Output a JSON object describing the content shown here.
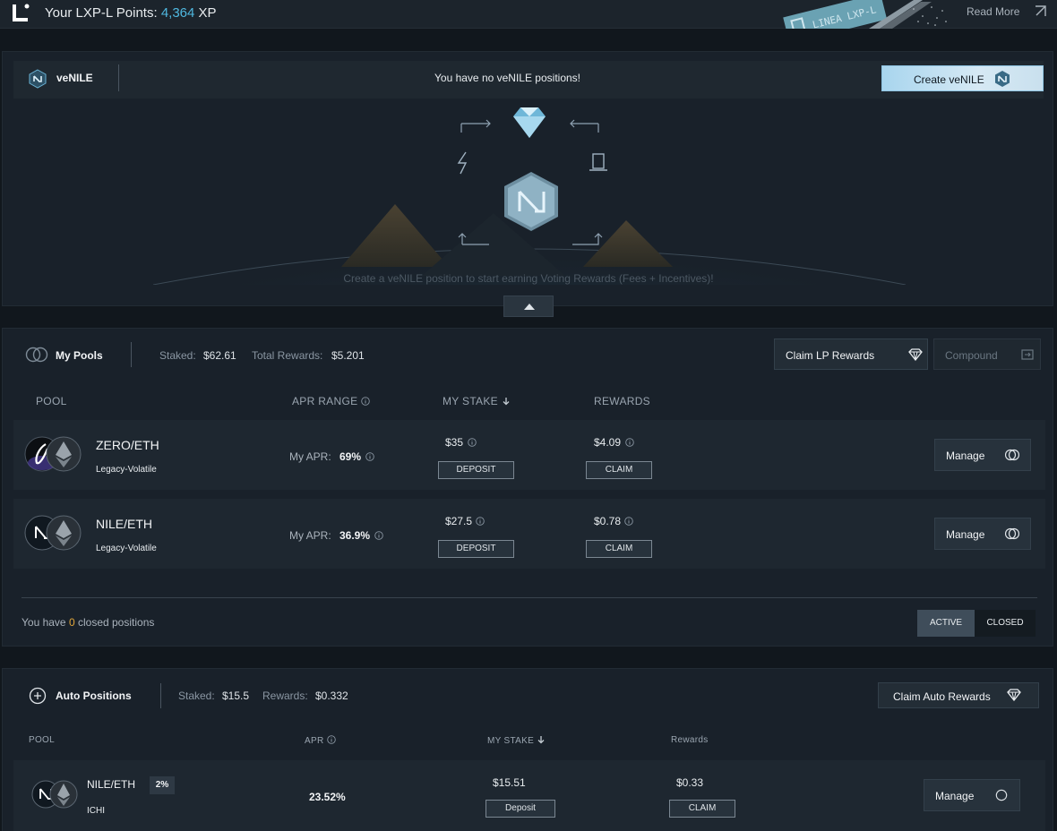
{
  "topbar": {
    "points_label": "Your LXP-L Points:",
    "points_value": "4,364",
    "points_unit": "XP",
    "banner_text": "LINEA LXP-L",
    "read_more": "Read More"
  },
  "venile": {
    "title": "veNILE",
    "empty_message": "You have no veNILE positions!",
    "create_button": "Create veNILE",
    "hint": "Create a veNILE position to start earning Voting Rewards (Fees + Incentives)!"
  },
  "my_pools": {
    "title": "My Pools",
    "staked_label": "Staked:",
    "staked_value": "$62.61",
    "rewards_label": "Total Rewards:",
    "rewards_value": "$5.201",
    "claim_button": "Claim LP Rewards",
    "compound_button": "Compound",
    "columns": {
      "pool": "POOL",
      "apr": "APR RANGE",
      "stake": "MY STAKE",
      "rewards": "REWARDS"
    },
    "rows": [
      {
        "name": "ZERO/ETH",
        "type": "Legacy-Volatile",
        "apr_label": "My APR:",
        "apr": "69%",
        "stake": "$35",
        "deposit": "DEPOSIT",
        "rewards": "$4.09",
        "claim": "CLAIM",
        "manage": "Manage"
      },
      {
        "name": "NILE/ETH",
        "type": "Legacy-Volatile",
        "apr_label": "My APR:",
        "apr": "36.9%",
        "stake": "$27.5",
        "deposit": "DEPOSIT",
        "rewards": "$0.78",
        "claim": "CLAIM",
        "manage": "Manage"
      }
    ],
    "closed_prefix": "You have",
    "closed_count": "0",
    "closed_suffix": "closed positions",
    "toggle_active": "ACTIVE",
    "toggle_closed": "CLOSED"
  },
  "auto_positions": {
    "title": "Auto Positions",
    "staked_label": "Staked:",
    "staked_value": "$15.5",
    "rewards_label": "Rewards:",
    "rewards_value": "$0.332",
    "claim_button": "Claim Auto Rewards",
    "columns": {
      "pool": "POOL",
      "apr": "APR",
      "stake": "MY STAKE",
      "rewards": "Rewards"
    },
    "rows": [
      {
        "name": "NILE/ETH",
        "fee": "2%",
        "type": "ICHI",
        "apr": "23.52%",
        "stake": "$15.51",
        "deposit": "Deposit",
        "rewards": "$0.33",
        "claim": "CLAIM",
        "manage": "Manage"
      }
    ]
  },
  "colors": {
    "accent": "#4fb8e0",
    "background": "#11171d",
    "panel": "#19212a",
    "row": "#1e2730",
    "closed_count": "#e0a63a"
  }
}
